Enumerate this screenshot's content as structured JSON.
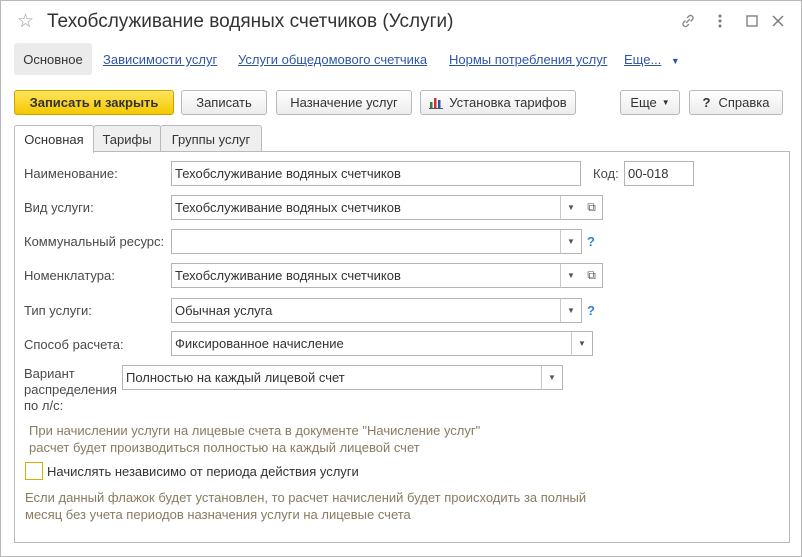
{
  "window": {
    "title": "Техобслуживание водяных счетчиков (Услуги)",
    "icons": [
      "star-icon",
      "link-icon",
      "more-vert-icon",
      "maximize-icon",
      "close-icon"
    ]
  },
  "nav": {
    "main": "Основное",
    "links": [
      "Зависимости услуг",
      "Услуги общедомового счетчика",
      "Нормы потребления услуг"
    ],
    "more": "Еще..."
  },
  "toolbar": {
    "save_close": "Записать и закрыть",
    "save": "Записать",
    "assign": "Назначение услуг",
    "tariffs": "Установка тарифов",
    "more": "Еще",
    "help": "Справка"
  },
  "tabs": [
    "Основная",
    "Тарифы",
    "Группы услуг"
  ],
  "form": {
    "name_label": "Наименование:",
    "name_value": "Техобслуживание водяных счетчиков",
    "code_label": "Код:",
    "code_value": "00-018",
    "service_kind_label": "Вид услуги:",
    "service_kind_value": "Техобслуживание водяных счетчиков",
    "resource_label": "Коммунальный ресурс:",
    "resource_value": "",
    "nomenclature_label": "Номенклатура:",
    "nomenclature_value": "Техобслуживание водяных счетчиков",
    "type_label": "Тип услуги:",
    "type_value": "Обычная услуга",
    "method_label": "Способ расчета:",
    "method_value": "Фиксированное начисление",
    "distribution_label_1": "Вариант",
    "distribution_label_2": "распределения",
    "distribution_label_3": "по л/с:",
    "distribution_value": "Полностью на каждый лицевой счет",
    "distribution_hint_1": "При начислении услуги на лицевые счета в документе \"Начисление услуг\"",
    "distribution_hint_2": "расчет будет производиться полностью на каждый лицевой счет",
    "independent_label": "Начислять независимо от периода действия услуги",
    "independent_hint_1": "Если данный флажок будет установлен, то расчет начислений будет происходить за полный",
    "independent_hint_2": "месяц без учета периодов назначения услуги на лицевые счета",
    "help_mark": "?"
  },
  "colors": {
    "accent_link": "#2f56a6",
    "primary_button": "#f5c800",
    "hint_text": "#8a7a60",
    "help_mark": "#2f86d6"
  }
}
